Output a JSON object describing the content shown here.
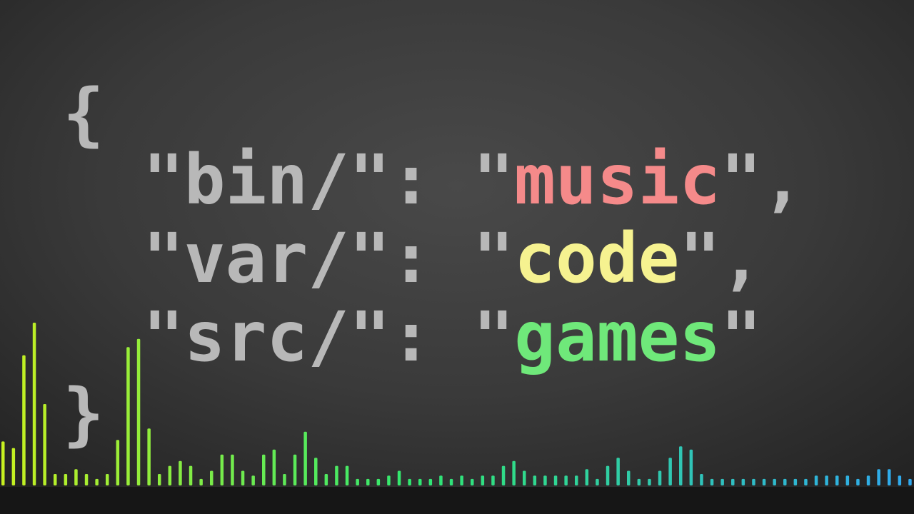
{
  "code": {
    "open_brace": "{",
    "close_brace": "}",
    "entries": [
      {
        "key": "\"bin/\"",
        "sep": ": ",
        "quote_open": "\"",
        "value": "music",
        "quote_close": "\"",
        "trail": ","
      },
      {
        "key": "\"var/\"",
        "sep": ": ",
        "quote_open": "\"",
        "value": "code",
        "quote_close": "\"",
        "trail": ","
      },
      {
        "key": "\"src/\"",
        "sep": ": ",
        "quote_open": "\"",
        "value": "games",
        "quote_close": "\"",
        "trail": ""
      }
    ]
  },
  "colors": {
    "text": "#b8b8b8",
    "music": "#f58a8a",
    "code": "#f6f290",
    "games": "#6fe87a",
    "visualizer_start": "#c8f020",
    "visualizer_mid": "#30e870",
    "visualizer_end": "#2fa8f0"
  },
  "visualizer": {
    "levels": [
      0.27,
      0.23,
      0.8,
      1.0,
      0.5,
      0.07,
      0.07,
      0.1,
      0.07,
      0.04,
      0.07,
      0.28,
      0.85,
      0.9,
      0.35,
      0.07,
      0.12,
      0.15,
      0.12,
      0.04,
      0.09,
      0.19,
      0.19,
      0.09,
      0.06,
      0.19,
      0.22,
      0.07,
      0.19,
      0.33,
      0.17,
      0.07,
      0.12,
      0.12,
      0.04,
      0.04,
      0.04,
      0.06,
      0.09,
      0.04,
      0.04,
      0.04,
      0.06,
      0.04,
      0.06,
      0.04,
      0.06,
      0.06,
      0.12,
      0.15,
      0.09,
      0.06,
      0.06,
      0.06,
      0.06,
      0.06,
      0.1,
      0.04,
      0.12,
      0.17,
      0.09,
      0.04,
      0.04,
      0.09,
      0.17,
      0.24,
      0.22,
      0.07,
      0.04,
      0.04,
      0.04,
      0.04,
      0.04,
      0.04,
      0.04,
      0.04,
      0.04,
      0.04,
      0.06,
      0.06,
      0.06,
      0.06,
      0.04,
      0.06,
      0.1,
      0.1,
      0.06,
      0.04,
      0.04,
      0.04,
      0.06,
      0.04,
      0.04,
      0.06,
      0.04,
      0.04,
      0.04,
      0.04
    ]
  }
}
